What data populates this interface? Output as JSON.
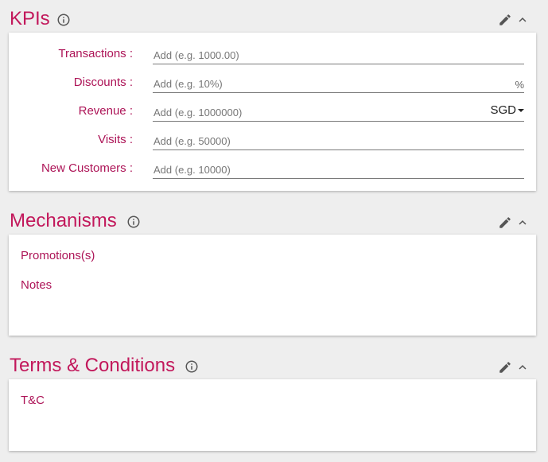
{
  "kpis": {
    "title": "KPIs",
    "fields": [
      {
        "label": "Transactions :",
        "placeholder": "Add (e.g. 1000.00)"
      },
      {
        "label": "Discounts :",
        "placeholder": "Add (e.g. 10%)",
        "suffix": "%"
      },
      {
        "label": "Revenue :",
        "placeholder": "Add (e.g. 1000000)",
        "currency": "SGD"
      },
      {
        "label": "Visits :",
        "placeholder": "Add (e.g. 50000)"
      },
      {
        "label": "New Customers :",
        "placeholder": "Add (e.g. 10000)"
      }
    ]
  },
  "mechanisms": {
    "title": "Mechanisms",
    "items": [
      "Promotions(s)",
      "Notes"
    ]
  },
  "terms": {
    "title": "Terms & Conditions",
    "items": [
      "T&C"
    ]
  },
  "icons": {
    "info": "info-icon",
    "edit": "pencil-icon",
    "collapse": "chevron-up-icon"
  },
  "colors": {
    "accent": "#c2185b",
    "label": "#ad1457",
    "background": "#eeeeee",
    "card": "#ffffff"
  }
}
